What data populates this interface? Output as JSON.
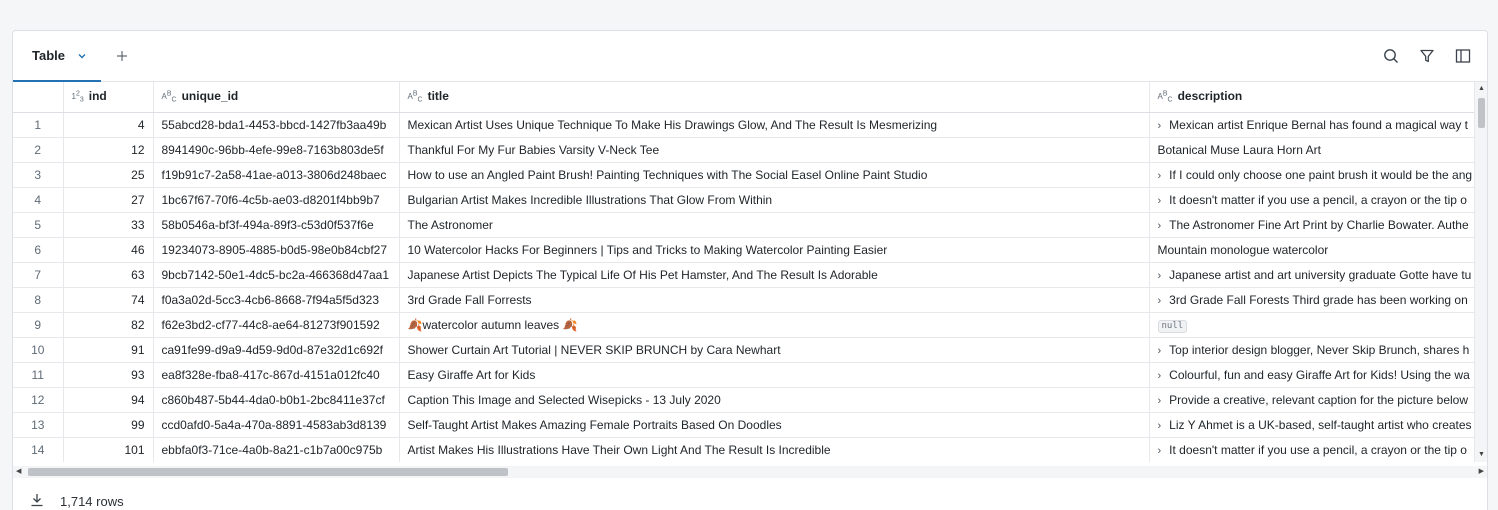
{
  "toolbar": {
    "tab_label": "Table",
    "icons": [
      "chevron-down-icon",
      "plus-icon",
      "search-icon",
      "filter-icon",
      "sidebar-toggle-icon"
    ]
  },
  "columns": [
    {
      "name": "",
      "type": ""
    },
    {
      "name": "ind",
      "type": "123"
    },
    {
      "name": "unique_id",
      "type": "ABC"
    },
    {
      "name": "title",
      "type": "ABC"
    },
    {
      "name": "description",
      "type": "ABC"
    }
  ],
  "rows": [
    {
      "n": "1",
      "ind": "4",
      "uid": "55abcd28-bda1-4453-bbcd-1427fb3aa49b",
      "title": "Mexican Artist Uses Unique Technique To Make His Drawings Glow, And The Result Is Mesmerizing",
      "desc": "Mexican artist Enrique Bernal has found a magical way t",
      "expand": true
    },
    {
      "n": "2",
      "ind": "12",
      "uid": "8941490c-96bb-4efe-99e8-7163b803de5f",
      "title": "Thankful For My Fur Babies Varsity V-Neck Tee",
      "desc": "Botanical Muse Laura Horn Art",
      "expand": false
    },
    {
      "n": "3",
      "ind": "25",
      "uid": "f19b91c7-2a58-41ae-a013-3806d248baec",
      "title": "How to use an Angled Paint Brush! Painting Techniques with The Social Easel Online Paint Studio",
      "desc": "If I could only choose one paint brush it would be the ang",
      "expand": true
    },
    {
      "n": "4",
      "ind": "27",
      "uid": "1bc67f67-70f6-4c5b-ae03-d8201f4bb9b7",
      "title": "Bulgarian Artist Makes Incredible Illustrations That Glow From Within",
      "desc": "It doesn't matter if you use a pencil, a crayon or the tip o",
      "expand": true
    },
    {
      "n": "5",
      "ind": "33",
      "uid": "58b0546a-bf3f-494a-89f3-c53d0f537f6e",
      "title": "The Astronomer",
      "desc": "The Astronomer Fine Art Print by Charlie Bowater. Authe",
      "expand": true
    },
    {
      "n": "6",
      "ind": "46",
      "uid": "19234073-8905-4885-b0d5-98e0b84cbf27",
      "title": "10 Watercolor Hacks For Beginners | Tips and Tricks to Making Watercolor Painting Easier",
      "desc": "Mountain monologue watercolor",
      "expand": false
    },
    {
      "n": "7",
      "ind": "63",
      "uid": "9bcb7142-50e1-4dc5-bc2a-466368d47aa1",
      "title": "Japanese Artist Depicts The Typical Life Of His Pet Hamster, And The Result Is Adorable",
      "desc": "Japanese artist and art university graduate Gotte have tu",
      "expand": true
    },
    {
      "n": "8",
      "ind": "74",
      "uid": "f0a3a02d-5cc3-4cb6-8668-7f94a5f5d323",
      "title": "3rd Grade Fall Forrests",
      "desc": "3rd Grade Fall Forests Third grade has been working on",
      "expand": true
    },
    {
      "n": "9",
      "ind": "82",
      "uid": "f62e3bd2-cf77-44c8-ae64-81273f901592",
      "title": "🍂watercolor autumn leaves 🍂",
      "desc": "null",
      "expand": false,
      "null": true
    },
    {
      "n": "10",
      "ind": "91",
      "uid": "ca91fe99-d9a9-4d59-9d0d-87e32d1c692f",
      "title": "Shower Curtain Art Tutorial | NEVER SKIP BRUNCH by Cara Newhart",
      "desc": "Top interior design blogger, Never Skip Brunch, shares h",
      "expand": true
    },
    {
      "n": "11",
      "ind": "93",
      "uid": "ea8f328e-fba8-417c-867d-4151a012fc40",
      "title": "Easy Giraffe Art for Kids",
      "desc": "Colourful, fun and easy Giraffe Art for Kids! Using the wa",
      "expand": true
    },
    {
      "n": "12",
      "ind": "94",
      "uid": "c860b487-5b44-4da0-b0b1-2bc8411e37cf",
      "title": "Caption This Image and Selected Wisepicks - 13 July 2020",
      "desc": "Provide a creative, relevant caption for the picture below",
      "expand": true
    },
    {
      "n": "13",
      "ind": "99",
      "uid": "ccd0afd0-5a4a-470a-8891-4583ab3d8139",
      "title": "Self-Taught Artist Makes Amazing Female Portraits Based On Doodles",
      "desc": "Liz Y Ahmet is a UK-based, self-taught artist who creates",
      "expand": true
    },
    {
      "n": "14",
      "ind": "101",
      "uid": "ebbfa0f3-71ce-4a0b-8a21-c1b7a00c975b",
      "title": "Artist Makes His Illustrations Have Their Own Light And The Result Is Incredible",
      "desc": "It doesn't matter if you use a pencil, a crayon or the tip o",
      "expand": true
    }
  ],
  "footer": {
    "row_count": "1,714 rows"
  },
  "colors": {
    "accent": "#2272b4"
  }
}
